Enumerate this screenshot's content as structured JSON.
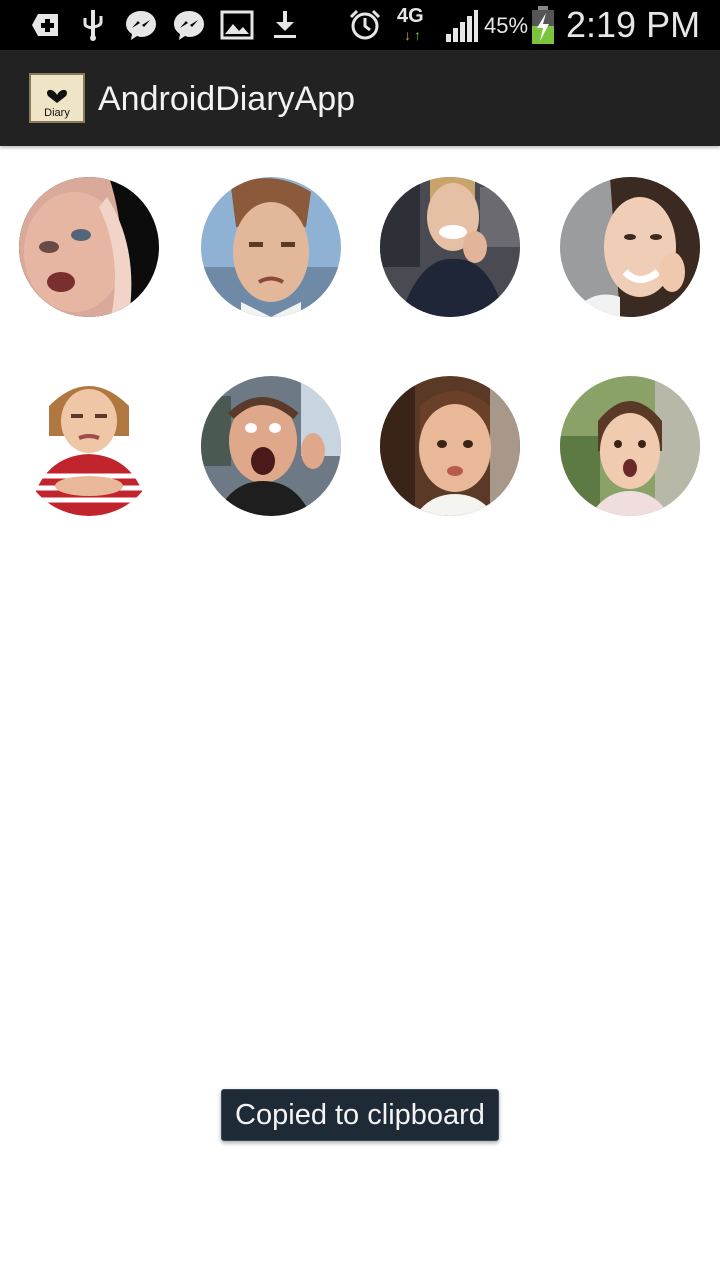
{
  "status_bar": {
    "icons_left": [
      "add-icon",
      "usb-icon",
      "messenger-icon",
      "messenger-icon",
      "image-icon",
      "download-icon"
    ],
    "icons_right": [
      "alarm-icon",
      "network-4g-icon",
      "signal-icon",
      "battery-charging-icon"
    ],
    "network_label": "4G",
    "battery_percent": "45%",
    "time": "2:19 PM"
  },
  "action_bar": {
    "app_icon_label": "Diary",
    "title": "AndroidDiaryApp"
  },
  "grid": {
    "items": [
      {
        "label": "angry-baby"
      },
      {
        "label": "pouting-boy"
      },
      {
        "label": "smiling-woman-hand-on-cheek"
      },
      {
        "label": "smiling-woman"
      },
      {
        "label": "grumpy-girl-arms-crossed"
      },
      {
        "label": "shouting-man"
      },
      {
        "label": "pouting-toddler"
      },
      {
        "label": "surprised-girl"
      }
    ]
  },
  "toast": {
    "text": "Copied to clipboard"
  }
}
